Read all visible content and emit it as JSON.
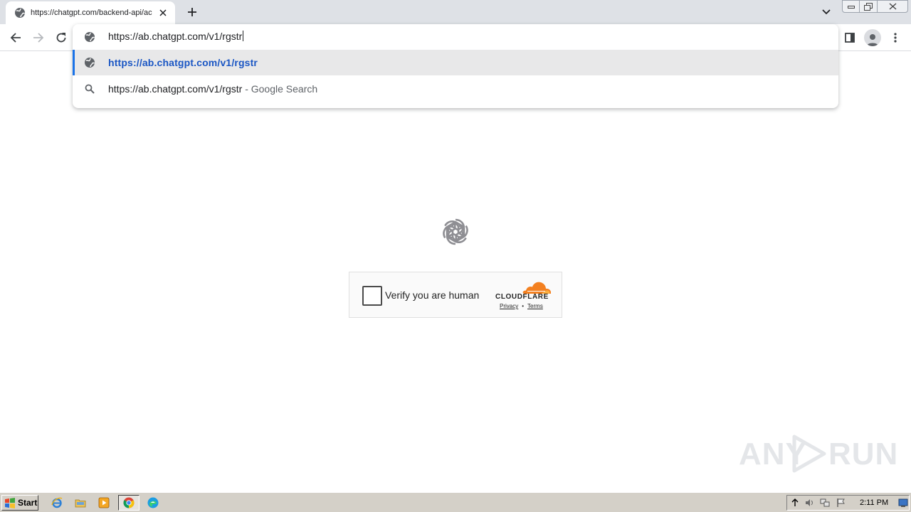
{
  "browser": {
    "tab": {
      "title": "https://chatgpt.com/backend-api/ac"
    },
    "omnibox": {
      "input_value": "https://ab.chatgpt.com/v1/rgstr",
      "suggestions": [
        {
          "text": "https://ab.chatgpt.com/v1/rgstr",
          "suffix": "",
          "icon": "globe-icon",
          "selected": true
        },
        {
          "text": "https://ab.chatgpt.com/v1/rgstr",
          "suffix": " - Google Search",
          "icon": "search-icon",
          "selected": false
        }
      ]
    },
    "colors": {
      "accent": "#1a73e8",
      "tabstrip_bg": "#dee1e6"
    }
  },
  "page": {
    "challenge": {
      "label": "Verify you are human",
      "provider": "CLOUDFLARE",
      "privacy": "Privacy",
      "separator": "•",
      "terms": "Terms",
      "brand_color": "#f38020"
    }
  },
  "watermark": {
    "left": "ANY",
    "right": "RUN"
  },
  "taskbar": {
    "start_label": "Start",
    "clock": "2:11 PM"
  }
}
